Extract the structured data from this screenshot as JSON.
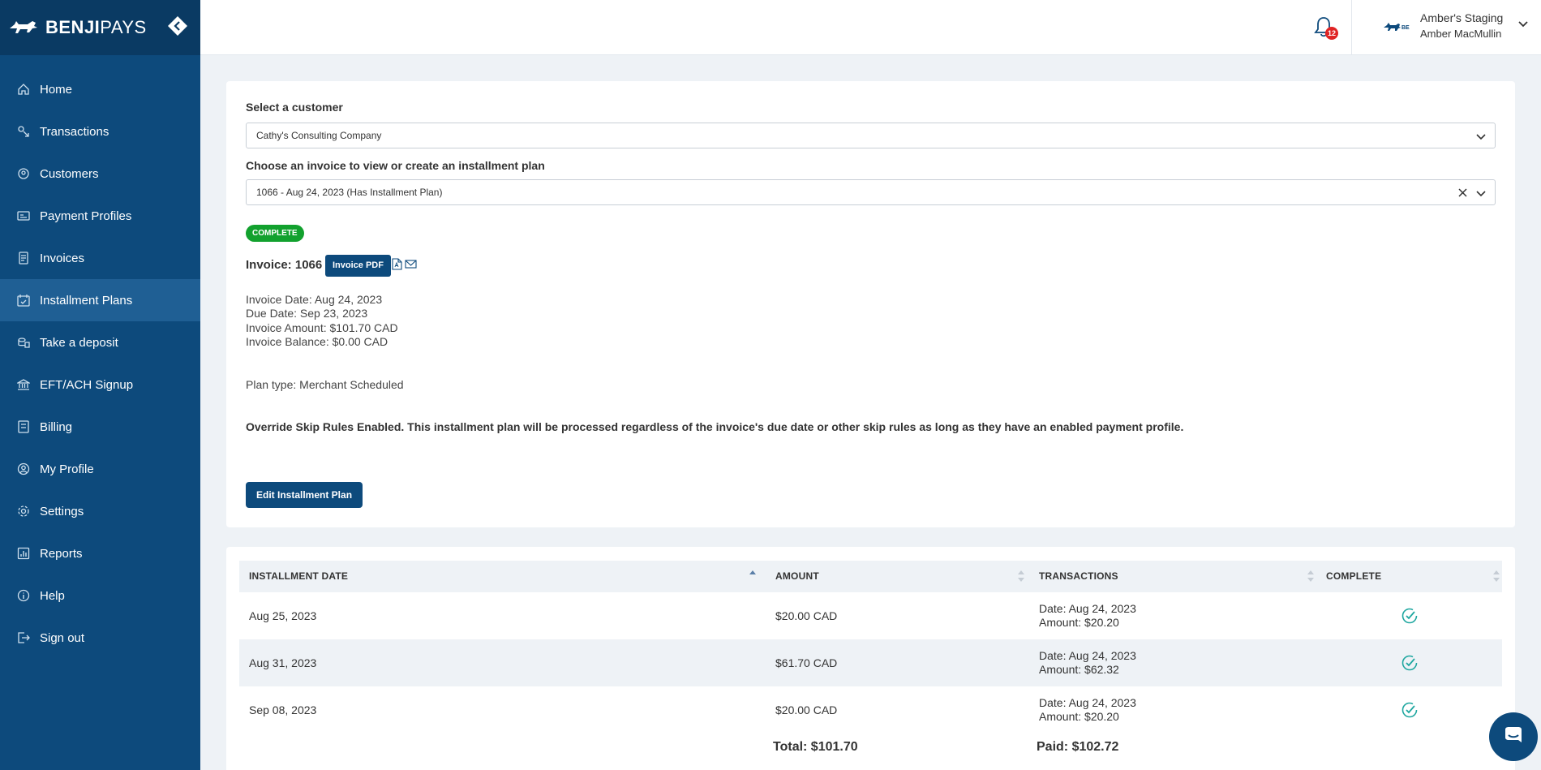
{
  "brand": {
    "name_bold": "BENJI",
    "name_light": "PAYS"
  },
  "sidebar": {
    "items": [
      {
        "label": "Home",
        "icon": "home-icon",
        "active": false
      },
      {
        "label": "Transactions",
        "icon": "transactions-icon",
        "active": false
      },
      {
        "label": "Customers",
        "icon": "customers-icon",
        "active": false
      },
      {
        "label": "Payment Profiles",
        "icon": "payment-profiles-icon",
        "active": false
      },
      {
        "label": "Invoices",
        "icon": "invoices-icon",
        "active": false
      },
      {
        "label": "Installment Plans",
        "icon": "calendar-icon",
        "active": true
      },
      {
        "label": "Take a deposit",
        "icon": "deposit-icon",
        "active": false
      },
      {
        "label": "EFT/ACH Signup",
        "icon": "bank-icon",
        "active": false
      },
      {
        "label": "Billing",
        "icon": "billing-icon",
        "active": false
      },
      {
        "label": "My Profile",
        "icon": "profile-icon",
        "active": false
      },
      {
        "label": "Settings",
        "icon": "gear-icon",
        "active": false
      },
      {
        "label": "Reports",
        "icon": "reports-icon",
        "active": false
      },
      {
        "label": "Help",
        "icon": "info-icon",
        "active": false
      },
      {
        "label": "Sign out",
        "icon": "sign-out-icon",
        "active": false
      }
    ]
  },
  "header": {
    "notification_count": "12",
    "account_name": "Amber's Staging",
    "user_name": "Amber MacMullin"
  },
  "form": {
    "customer_label": "Select a customer",
    "customer_value": "Cathy's Consulting Company",
    "invoice_label": "Choose an invoice to view or create an installment plan",
    "invoice_value": "1066 - Aug 24, 2023 (Has Installment Plan)"
  },
  "invoice": {
    "status": "COMPLETE",
    "title": "Invoice: 1066",
    "pdf_label": "Invoice PDF",
    "date": "Invoice Date: Aug 24, 2023",
    "due": "Due Date: Sep 23, 2023",
    "amount": "Invoice Amount: $101.70 CAD",
    "balance": "Invoice Balance: $0.00 CAD",
    "plan_type": "Plan type: Merchant Scheduled",
    "override": "Override Skip Rules Enabled. This installment plan will be processed regardless of the invoice's due date or other skip rules as long as they have an enabled payment profile.",
    "edit_label": "Edit Installment Plan"
  },
  "table": {
    "headers": [
      "INSTALLMENT DATE",
      "AMOUNT",
      "TRANSACTIONS",
      "COMPLETE"
    ],
    "rows": [
      {
        "date": "Aug 25, 2023",
        "amount": "$20.00 CAD",
        "tx_date": "Date: Aug 24, 2023",
        "tx_amount": "Amount: $20.20",
        "complete": true
      },
      {
        "date": "Aug 31, 2023",
        "amount": "$61.70 CAD",
        "tx_date": "Date: Aug 24, 2023",
        "tx_amount": "Amount: $62.32",
        "complete": true
      },
      {
        "date": "Sep 08, 2023",
        "amount": "$20.00 CAD",
        "tx_date": "Date: Aug 24, 2023",
        "tx_amount": "Amount: $20.20",
        "complete": true
      }
    ],
    "total": "Total: $101.70",
    "paid": "Paid: $102.72"
  },
  "colors": {
    "primary": "#0d4a7c",
    "sidebar": "#0d4a7c",
    "active_item": "#1f5f94",
    "complete_badge": "#12a12e",
    "check": "#1fa7a0"
  }
}
